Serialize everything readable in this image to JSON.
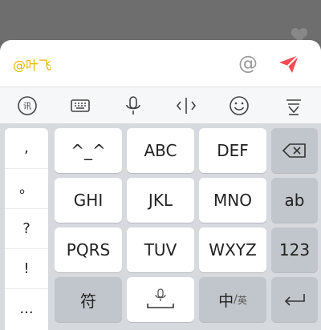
{
  "composer": {
    "mention": "@叶飞",
    "at_symbol": "@"
  },
  "toolbar": {
    "icons": [
      "translate-icon",
      "keyboard-icon",
      "microphone-icon",
      "cursor-icon",
      "emoji-icon",
      "collapse-keyboard-icon"
    ]
  },
  "keyboard": {
    "side": [
      ",",
      "。",
      "?",
      "!",
      "..."
    ],
    "rows": [
      [
        "^_^",
        "ABC",
        "DEF"
      ],
      [
        "GHI",
        "JKL",
        "MNO",
        "ab"
      ],
      [
        "PQRS",
        "TUV",
        "WXYZ",
        "123"
      ]
    ],
    "bottom": {
      "symbols": "符",
      "lang_main": "中",
      "lang_sub": "英"
    }
  },
  "colors": {
    "mention": "#e8b600",
    "send": "#f44c54",
    "key_dark": "#c1c6cc",
    "key_light": "#ffffff"
  }
}
